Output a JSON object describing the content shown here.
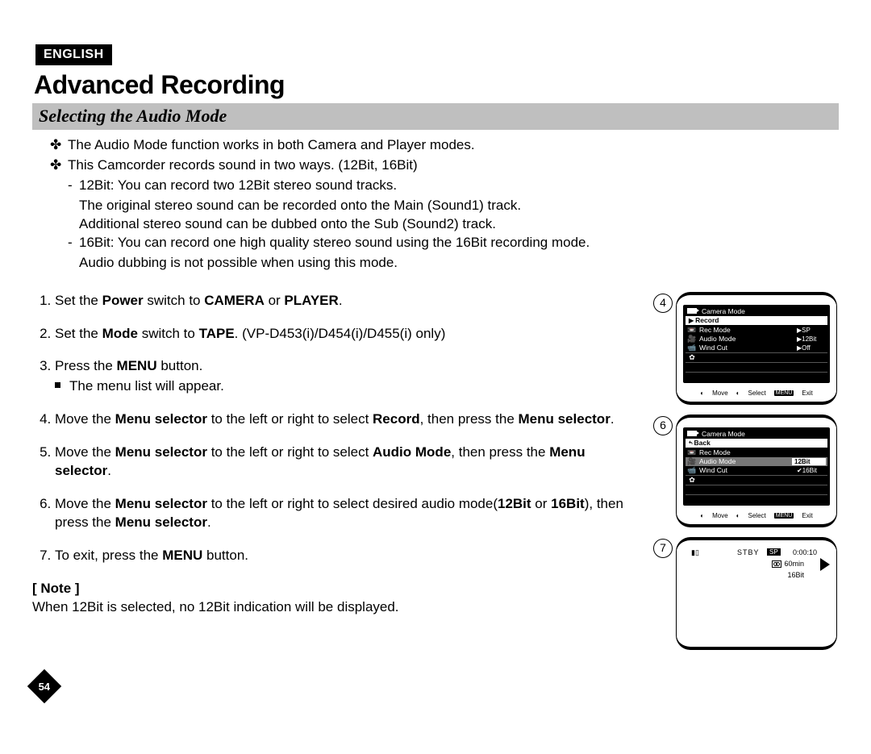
{
  "language_badge": "ENGLISH",
  "main_title": "Advanced Recording",
  "section_title": "Selecting the Audio Mode",
  "intro": {
    "b1": "The Audio Mode function works in both Camera and Player modes.",
    "b2": "This Camcorder records sound in two ways. (12Bit, 16Bit)",
    "s1a": "12Bit: You can record two 12Bit stereo sound tracks.",
    "s1b": "The original stereo sound can be recorded onto the Main (Sound1) track.",
    "s1c": "Additional stereo sound can be dubbed onto the Sub (Sound2) track.",
    "s2a": "16Bit: You can record one high quality stereo sound using the 16Bit recording mode.",
    "s2b": "Audio dubbing is not possible when using this mode."
  },
  "steps": {
    "s1_pre": "Set the ",
    "s1_b1": "Power",
    "s1_mid": " switch to ",
    "s1_b2": "CAMERA",
    "s1_or": " or ",
    "s1_b3": "PLAYER",
    "s1_end": ".",
    "s2_pre": "Set the ",
    "s2_b1": "Mode",
    "s2_mid": " switch to ",
    "s2_b2": "TAPE",
    "s2_end": ". (VP-D453(i)/D454(i)/D455(i) only)",
    "s3_pre": "Press the ",
    "s3_b1": "MENU",
    "s3_end": " button.",
    "s3_sub": "The menu list will appear.",
    "s4_pre": "Move the ",
    "s4_b1": "Menu selector",
    "s4_mid": " to the left or right to select ",
    "s4_b2": "Record",
    "s4_mid2": ", then press the ",
    "s4_b3": "Menu selector",
    "s4_end": ".",
    "s5_pre": "Move the ",
    "s5_b1": "Menu selector",
    "s5_mid": " to the left or right to select ",
    "s5_b2": "Audio Mode",
    "s5_mid2": ", then press the ",
    "s5_b3": "Menu selector",
    "s5_end": ".",
    "s6_pre": "Move the ",
    "s6_b1": "Menu selector",
    "s6_mid": " to the left or right to select desired audio mode(",
    "s6_b2": "12Bit",
    "s6_or": " or ",
    "s6_b3": "16Bit",
    "s6_mid2": "), then press the ",
    "s6_b4": "Menu selector",
    "s6_end": ".",
    "s7_pre": "To exit, press the ",
    "s7_b1": "MENU",
    "s7_end": " button."
  },
  "note_label": "[ Note ]",
  "note_text": "When 12Bit is selected, no 12Bit indication will be displayed.",
  "page_number": "54",
  "lcd4": {
    "title": "Camera Mode",
    "top": "Record",
    "rows": [
      {
        "icon": "📼",
        "label": "Rec Mode",
        "value": "▶SP"
      },
      {
        "icon": "🎥",
        "label": "Audio Mode",
        "value": "▶12Bit"
      },
      {
        "icon": "📹",
        "label": "Wind Cut",
        "value": "▶Off"
      }
    ],
    "footer": {
      "move": "Move",
      "select": "Select",
      "menu": "MENU",
      "exit": "Exit"
    }
  },
  "lcd6": {
    "title": "Camera Mode",
    "top": "Back",
    "rows": [
      {
        "icon": "📼",
        "label": "Rec Mode",
        "value": ""
      },
      {
        "icon": "🎥",
        "label": "Audio Mode",
        "value": "12Bit",
        "highlight": true
      },
      {
        "icon": "📹",
        "label": "Wind Cut",
        "value": "✔16Bit"
      }
    ],
    "footer": {
      "move": "Move",
      "select": "Select",
      "menu": "MENU",
      "exit": "Exit"
    }
  },
  "lcd7": {
    "stby": "STBY",
    "sp": "SP",
    "time": "0:00:10",
    "remain": "60min",
    "bit": "16Bit"
  },
  "step_nums": {
    "d4": "4",
    "d6": "6",
    "d7": "7"
  }
}
